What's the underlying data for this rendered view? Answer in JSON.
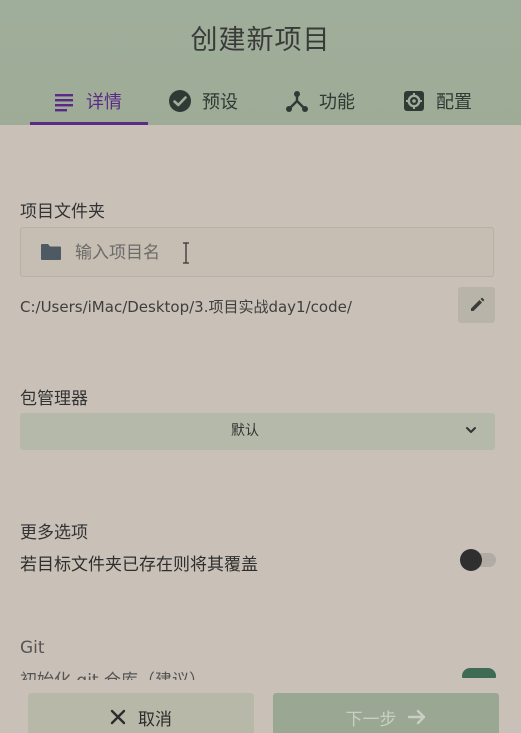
{
  "header": {
    "title": "创建新项目",
    "tabs": [
      {
        "label": "详情",
        "icon": "list-icon",
        "active": true
      },
      {
        "label": "预设",
        "icon": "check-circle-icon",
        "active": false
      },
      {
        "label": "功能",
        "icon": "fork-icon",
        "active": false
      },
      {
        "label": "配置",
        "icon": "gear-icon",
        "active": false
      }
    ]
  },
  "folder": {
    "label": "项目文件夹",
    "input_placeholder": "输入项目名",
    "input_value": "",
    "path": "C:/Users/iMac/Desktop/3.项目实战day1/code/"
  },
  "package_manager": {
    "label": "包管理器",
    "selected": "默认"
  },
  "more_options": {
    "label": "更多选项",
    "overwrite_label": "若目标文件夹已存在则将其覆盖",
    "overwrite_enabled": false
  },
  "git": {
    "label": "Git",
    "init_label": "初始化 git 仓库（建议）",
    "init_enabled": true
  },
  "footer": {
    "cancel_label": "取消",
    "next_label": "下一步"
  },
  "colors": {
    "header_bg": "#9fae9a",
    "accent": "#5b2a86",
    "page_bg": "#c9c1b7",
    "git_toggle_on": "#3d6b53"
  }
}
